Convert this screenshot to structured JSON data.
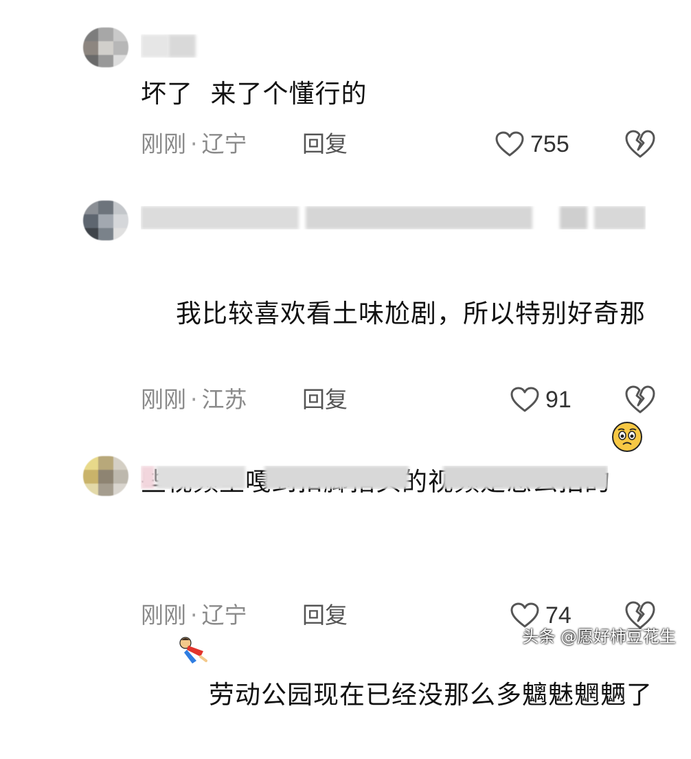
{
  "comments": [
    {
      "text": "坏了  来了个懂行的",
      "time": "刚刚",
      "location": "辽宁",
      "reply_label": "回复",
      "likes": "755",
      "emoji": null
    },
    {
      "text": "我比较喜欢看土味尬剧，所以特别好奇那些视频里嘎到扣脚指头的视频是怎么拍的",
      "time": "刚刚",
      "location": "江苏",
      "reply_label": "回复",
      "likes": "91",
      "emoji": "pleading-face-emoji"
    },
    {
      "text": "劳动公园现在已经没那么多魑魅魍魉了",
      "time": "刚刚",
      "location": "辽宁",
      "reply_label": "回复",
      "likes": "74",
      "emoji": "flying-doll-sticker"
    }
  ],
  "separator": "·",
  "colors": {
    "meta_gray": "#8a8a8a",
    "text": "#111111",
    "icon_gray": "#555555"
  },
  "watermark": "头条 @愿好柿豆花生"
}
